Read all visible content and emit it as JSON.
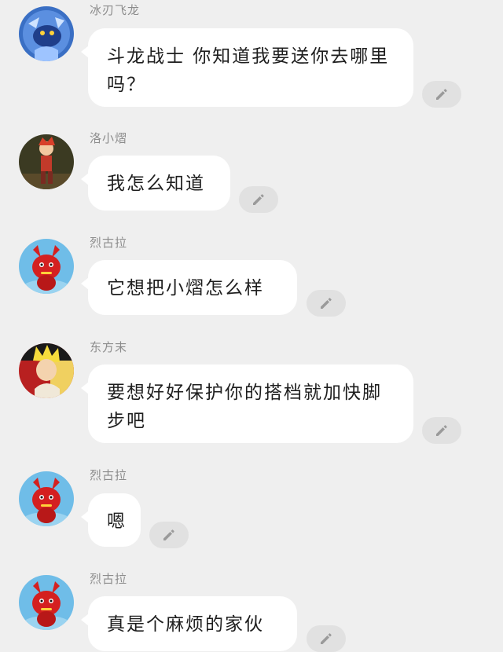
{
  "messages": [
    {
      "sender": "冰刃飞龙",
      "text": "斗龙战士 你知道我要送你去哪里吗？",
      "avatar": "blue-dragon-avatar"
    },
    {
      "sender": "洛小熠",
      "text": "我怎么知道",
      "avatar": "red-haired-boy-avatar"
    },
    {
      "sender": "烈古拉",
      "text": "它想把小熠怎么样",
      "avatar": "red-dragon-avatar"
    },
    {
      "sender": "东方末",
      "text": "要想好好保护你的搭档就加快脚步吧",
      "avatar": "blonde-boy-avatar"
    },
    {
      "sender": "烈古拉",
      "text": "嗯",
      "avatar": "red-dragon-avatar"
    },
    {
      "sender": "烈古拉",
      "text": "真是个麻烦的家伙",
      "avatar": "red-dragon-avatar"
    }
  ],
  "icons": {
    "edit": "pencil-icon"
  },
  "colors": {
    "background": "#efefef",
    "bubble": "#ffffff",
    "edit_button": "#e1e1e1",
    "sender_text": "#8c8c8c"
  }
}
